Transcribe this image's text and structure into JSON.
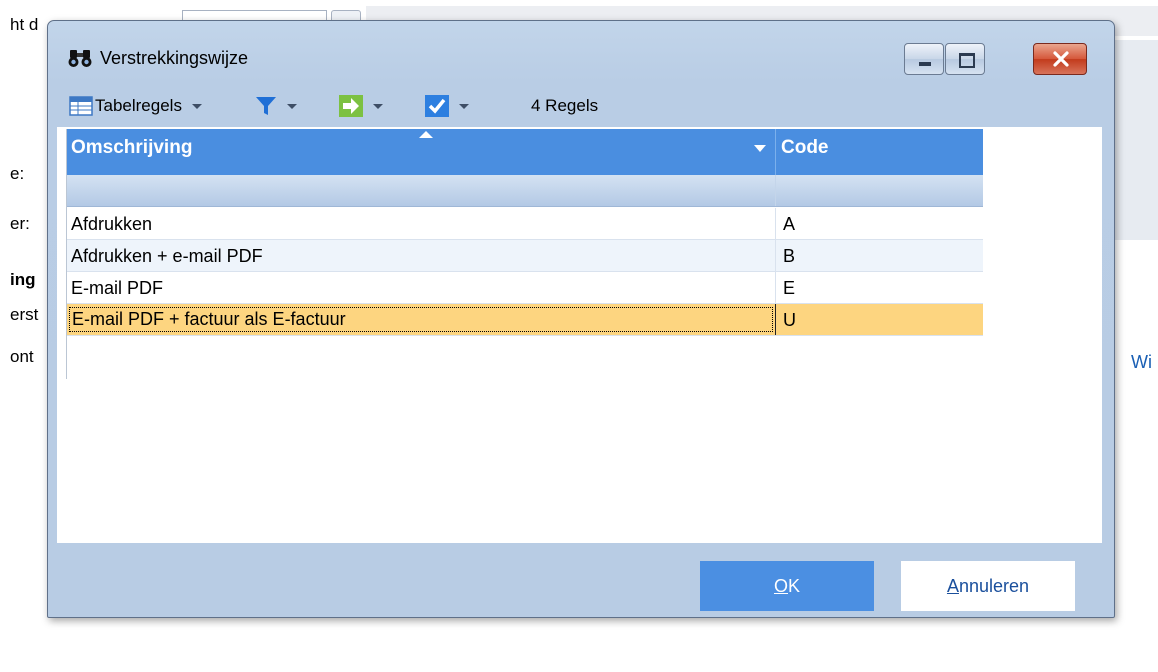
{
  "background": {
    "labels": [
      "ht d",
      "e:",
      "er:",
      "ing",
      "erst",
      "ont"
    ],
    "link": "Wi"
  },
  "dialog": {
    "title": "Verstrekkingswijze",
    "toolbar": {
      "tabelregels": "Tabelregels",
      "count": "4 Regels"
    },
    "grid": {
      "columns": [
        "Omschrijving",
        "Code"
      ],
      "rows": [
        {
          "omschrijving": "Afdrukken",
          "code": "A"
        },
        {
          "omschrijving": "Afdrukken +  e-mail PDF",
          "code": "B"
        },
        {
          "omschrijving": "E-mail PDF",
          "code": "E"
        },
        {
          "omschrijving": "E-mail PDF + factuur als E-factuur",
          "code": "U"
        }
      ],
      "selected_index": 3
    },
    "buttons": {
      "ok_mnemonic": "O",
      "ok_rest": "K",
      "cancel_mnemonic": "A",
      "cancel_rest": "nnuleren"
    }
  },
  "colors": {
    "accent": "#4a8ee0",
    "selected_row": "#fdd580",
    "dialog_frame": "#b9cde5"
  }
}
